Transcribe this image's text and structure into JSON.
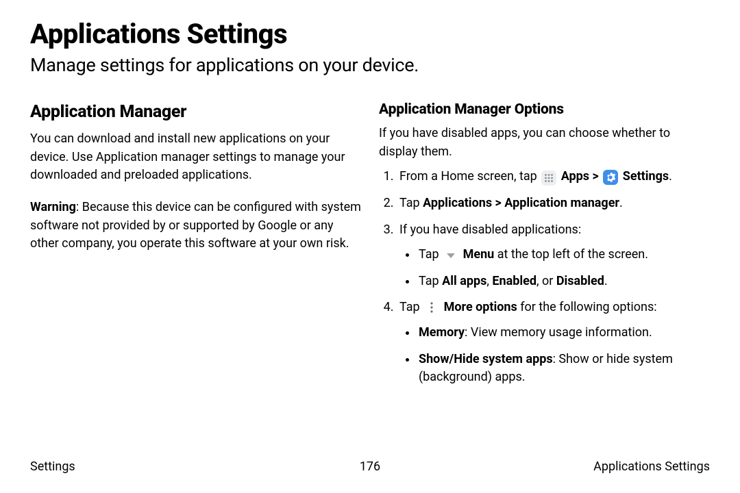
{
  "title": "Applications Settings",
  "subtitle": "Manage settings for applications on your device.",
  "left": {
    "heading": "Application Manager",
    "p1": "You can download and install new applications on your device. Use Application manager settings to manage your downloaded and preloaded applications.",
    "warning_label": "Warning",
    "warning_rest": ": Because this device can be configured with system software not provided by or supported by Google or any other company, you operate this software at your own risk."
  },
  "right": {
    "heading": "Application Manager Options",
    "intro": "If you have disabled apps, you can choose whether to display them.",
    "step1_a": "From a Home screen, tap ",
    "step1_apps": " Apps",
    "step1_sep": " > ",
    "step1_settings": " Settings",
    "step1_end": ".",
    "step2_a": "Tap ",
    "step2_b": "Applications > Application manager",
    "step2_c": ".",
    "step3": "If you have disabled applications:",
    "b1_a": "Tap ",
    "b1_menu": " Menu",
    "b1_rest": " at the top left of the screen.",
    "b2_a": "Tap ",
    "b2_b": "All apps",
    "b2_c": ", ",
    "b2_d": "Enabled",
    "b2_e": ", or ",
    "b2_f": "Disabled",
    "b2_g": ".",
    "step4_a": "Tap ",
    "step4_more": " More options",
    "step4_rest": " for the following options:",
    "b3_a": "Memory",
    "b3_b": ": View memory usage information.",
    "b4_a": "Show/Hide system apps",
    "b4_b": ": Show or hide system (background) apps."
  },
  "footer": {
    "left": "Settings",
    "center": "176",
    "right": "Applications Settings"
  }
}
